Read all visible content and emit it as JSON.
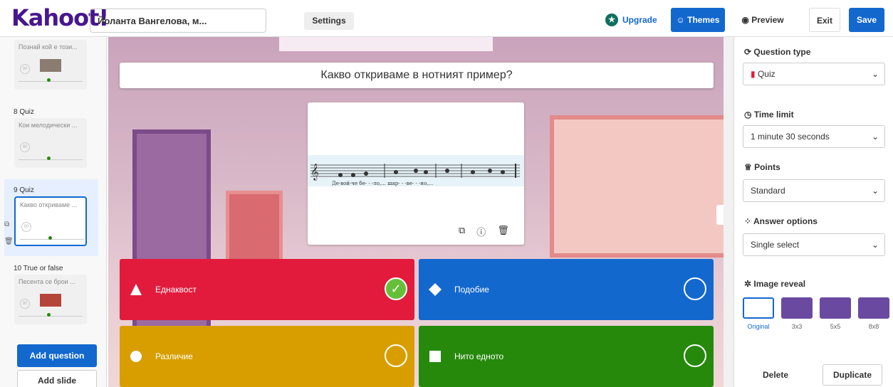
{
  "header": {
    "logo": "Kahoot!",
    "title": "Йоланта Вангелова, м...",
    "settings": "Settings",
    "upgrade": "Upgrade",
    "themes": "Themes",
    "preview": "Preview",
    "exit": "Exit",
    "save": "Save"
  },
  "sidebar": {
    "items": [
      {
        "label": "",
        "preview": "Познай кой е този..."
      },
      {
        "label": "8  Quiz",
        "preview": "Кои мелодически ..."
      },
      {
        "label": "9  Quiz",
        "preview": "Какво откриваме ..."
      },
      {
        "label": "10  True or false",
        "preview": "Песента се брои ..."
      }
    ],
    "add_question": "Add question",
    "add_slide": "Add slide"
  },
  "question": {
    "text": "Какво откриваме в нотният пример?",
    "lyrics": "Де-вой-че   бе- - -ло,...   шар- - -ве- - -но,..."
  },
  "answers": [
    {
      "text": "Еднаквост",
      "color": "#e21b3c",
      "correct": true
    },
    {
      "text": "Подобие",
      "color": "#1368ce",
      "correct": false
    },
    {
      "text": "Различие",
      "color": "#d89e00",
      "correct": false
    },
    {
      "text": "Нито едното",
      "color": "#26890c",
      "correct": false
    }
  ],
  "panel": {
    "question_type_label": "Question type",
    "question_type_value": "Quiz",
    "time_limit_label": "Time limit",
    "time_limit_value": "1 minute 30 seconds",
    "points_label": "Points",
    "points_value": "Standard",
    "answer_options_label": "Answer options",
    "answer_options_value": "Single select",
    "image_reveal_label": "Image reveal",
    "reveal_options": [
      "Original",
      "3x3",
      "5x5",
      "8x8"
    ],
    "delete": "Delete",
    "duplicate": "Duplicate"
  }
}
